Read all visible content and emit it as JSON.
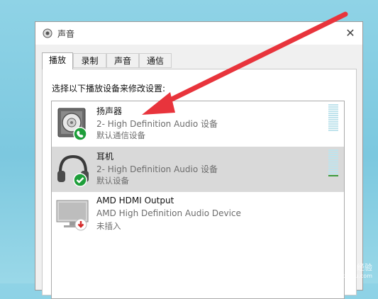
{
  "window": {
    "title": "声音",
    "close_glyph": "✕"
  },
  "tabs": [
    {
      "label": "播放",
      "active": true
    },
    {
      "label": "录制",
      "active": false
    },
    {
      "label": "声音",
      "active": false
    },
    {
      "label": "通信",
      "active": false
    }
  ],
  "instruction": "选择以下播放设备来修改设置:",
  "devices": [
    {
      "name": "扬声器",
      "description": "2- High Definition Audio 设备",
      "status": "默认通信设备",
      "icon": "speaker-icon",
      "badge": "phone-badge-icon",
      "selected": false
    },
    {
      "name": "耳机",
      "description": "2- High Definition Audio 设备",
      "status": "默认设备",
      "icon": "headphones-icon",
      "badge": "check-badge-icon",
      "selected": true
    },
    {
      "name": "AMD HDMI Output",
      "description": "AMD High Definition Audio Device",
      "status": "未插入",
      "icon": "monitor-icon",
      "badge": "unplugged-badge-icon",
      "selected": false
    }
  ],
  "watermark": {
    "line1": "Baidu 经验",
    "line2": "jingyan.baidu.com"
  },
  "colors": {
    "annotation_arrow": "#e8343c",
    "selected_row": "#d9d9d9",
    "status_green": "#1e9e3a"
  }
}
